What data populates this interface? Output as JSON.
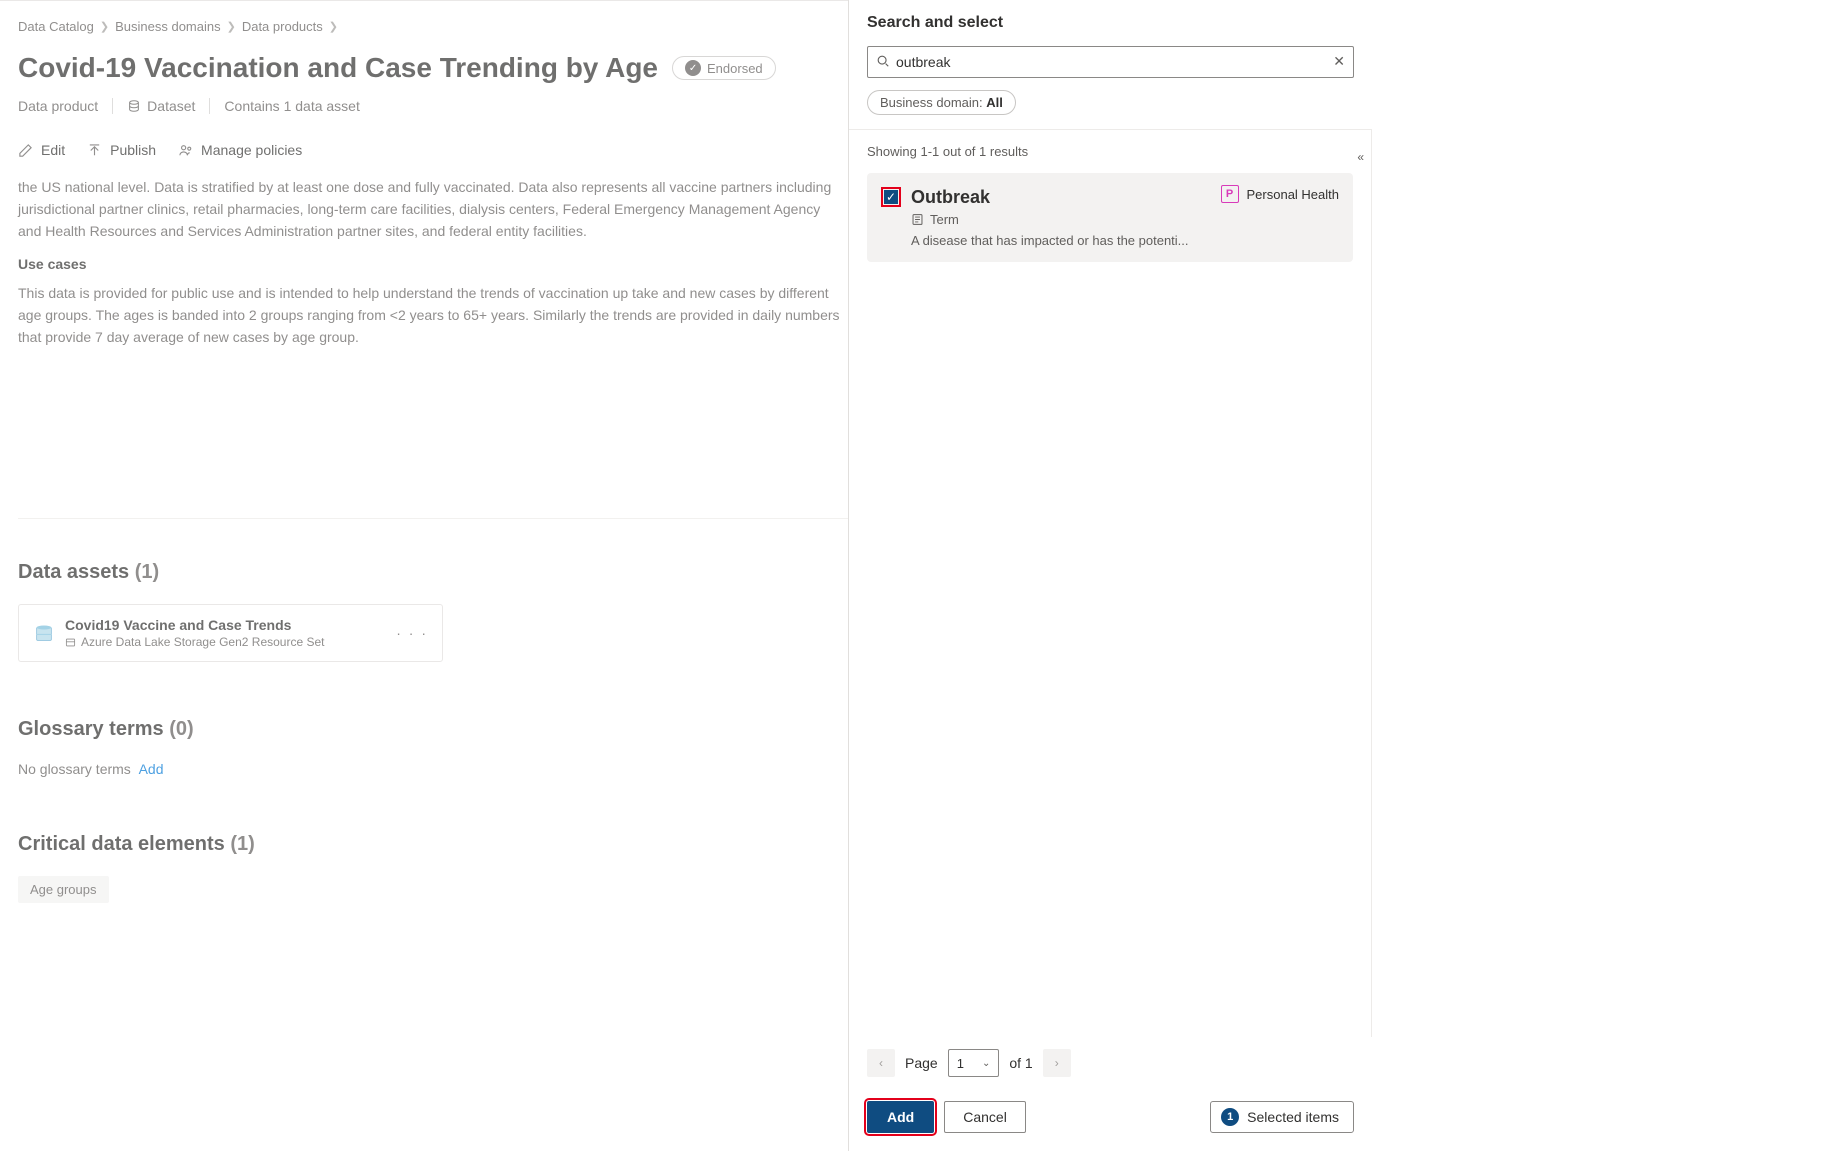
{
  "breadcrumb": [
    "Data Catalog",
    "Business domains",
    "Data products"
  ],
  "page": {
    "title": "Covid-19 Vaccination and Case Trending by Age",
    "endorsed": "Endorsed",
    "meta": {
      "product": "Data product",
      "dataset": "Dataset",
      "assets": "Contains 1 data asset"
    }
  },
  "actions": {
    "edit": "Edit",
    "publish": "Publish",
    "policies": "Manage policies"
  },
  "description": "the US national level. Data is stratified by at least one dose and fully vaccinated. Data also represents all vaccine partners including jurisdictional partner clinics, retail pharmacies, long-term care facilities, dialysis centers, Federal Emergency Management Agency and Health Resources and Services Administration partner sites, and federal entity facilities.",
  "usecases": {
    "heading": "Use cases",
    "body": "This data is provided for public use and is intended to help understand the trends of vaccination up take and new cases by different age groups.  The ages is banded into 2 groups ranging from <2 years to 65+ years.  Similarly the trends are provided in daily numbers that provide 7 day average of new cases by age group."
  },
  "assets": {
    "heading": "Data assets",
    "count": "(1)",
    "item": {
      "title": "Covid19 Vaccine and Case Trends",
      "subtitle": "Azure Data Lake Storage Gen2 Resource Set"
    }
  },
  "glossary": {
    "heading": "Glossary terms",
    "count": "(0)",
    "empty": "No glossary terms",
    "add": "Add"
  },
  "cde": {
    "heading": "Critical data elements",
    "count": "(1)",
    "chip": "Age groups"
  },
  "panel": {
    "title": "Search and select",
    "search_value": "outbreak",
    "domain_label": "Business domain:",
    "domain_value": "All",
    "result_count_text": "Showing 1-1 out of 1 results",
    "result": {
      "title": "Outbreak",
      "type": "Term",
      "desc": "A disease that has impacted or has the potenti...",
      "tag": "Personal Health",
      "tag_initial": "P"
    },
    "pager": {
      "page_label": "Page",
      "page_num": "1",
      "of_label": "of 1"
    },
    "add": "Add",
    "cancel": "Cancel",
    "selected": {
      "count": "1",
      "label": "Selected items"
    }
  }
}
